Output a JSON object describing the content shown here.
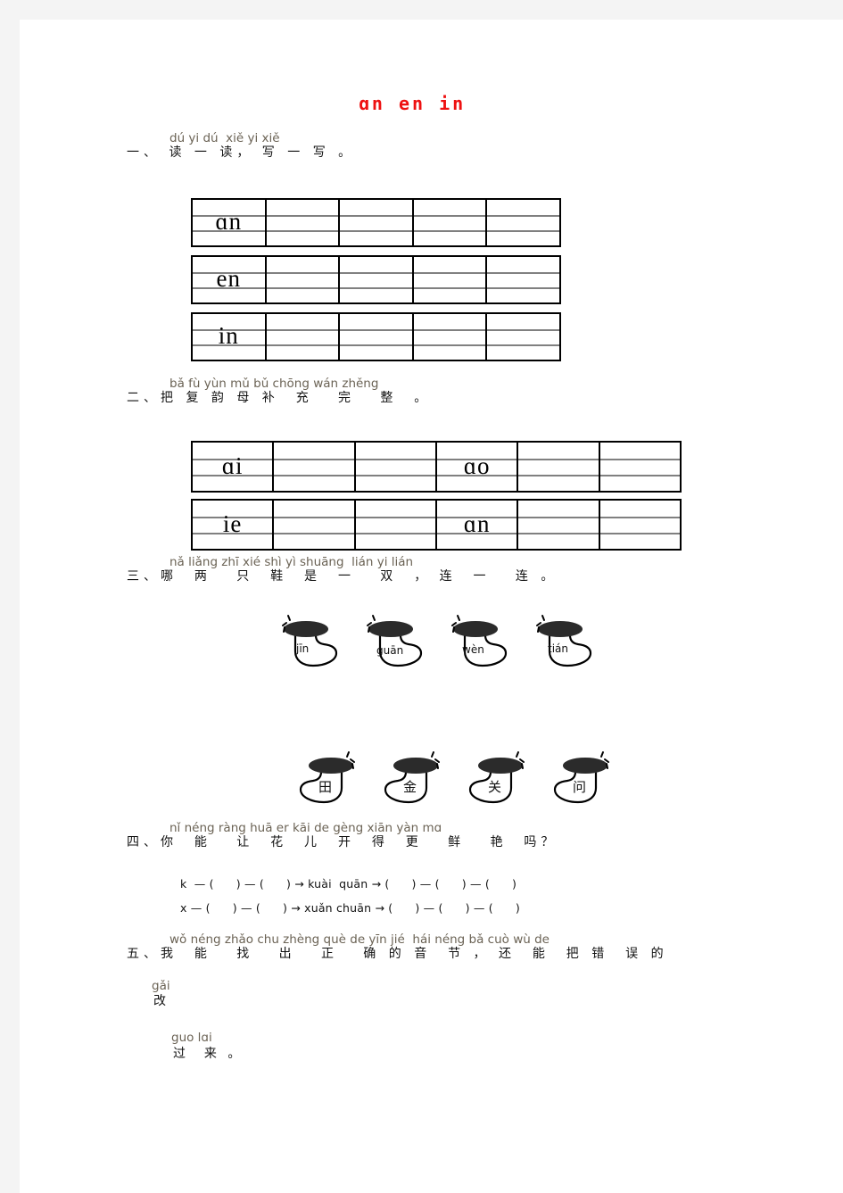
{
  "page": {
    "title_pinyin": "ɑn  en  in",
    "title_color": "#ee1111",
    "background": "#ffffff",
    "margin_color": "#f4f4f4"
  },
  "sections": [
    {
      "number": "一、",
      "pinyin": "dú yi dú  xiě yi xiě",
      "hanzi": "一、 读 一 读， 写 一 写 。",
      "grids": [
        {
          "columns": 5,
          "cells": [
            "ɑn",
            "",
            "",
            "",
            ""
          ]
        },
        {
          "columns": 5,
          "cells": [
            "en",
            "",
            "",
            "",
            ""
          ]
        },
        {
          "columns": 5,
          "cells": [
            "in",
            "",
            "",
            "",
            ""
          ]
        }
      ]
    },
    {
      "number": "二、",
      "pinyin": "bǎ fù yùn mǔ bǔ chōng wán zhěng",
      "hanzi": "二、把 复 韵 母 补  充   完   整  。",
      "grids": [
        {
          "columns": 6,
          "cells": [
            "ɑi",
            "",
            "",
            "ɑo",
            "",
            ""
          ]
        },
        {
          "columns": 6,
          "cells": [
            "ie",
            "",
            "",
            "ɑn",
            "",
            ""
          ]
        }
      ]
    },
    {
      "number": "三、",
      "pinyin": "nǎ liǎng zhī xié shì yì shuāng  lián yi lián",
      "hanzi": "三、哪  两   只  鞋  是  一   双  ， 连  一   连 。",
      "boots_top": [
        "jīn",
        "guān",
        "wèn",
        "tián"
      ],
      "boots_bottom": [
        "田",
        "金",
        "关",
        "问"
      ]
    },
    {
      "number": "四、",
      "pinyin": "nǐ néng ràng huā er kāi de gèng xiān yàn mɑ",
      "hanzi": "四、你  能   让  花  儿  开  得  更   鲜   艳  吗？",
      "exercises": [
        "k  — (      ) — (      ) → kuài  quān → (      ) — (      ) — (      )",
        "x — (      ) — (      ) → xuǎn chuān → (      ) — (      ) — (      )"
      ]
    },
    {
      "number": "五、",
      "pinyin": "wǒ néng zhǎo chu zhèng què de yīn jié  hái néng bǎ cuò wù de",
      "hanzi": "五、我  能   找   出   正   确 的 音  节 ， 还  能  把 错  误 的",
      "pinyin2": "gǎi",
      "hanzi2": "改",
      "pinyin3": "guo lɑi",
      "hanzi3": "过  来 。"
    }
  ]
}
